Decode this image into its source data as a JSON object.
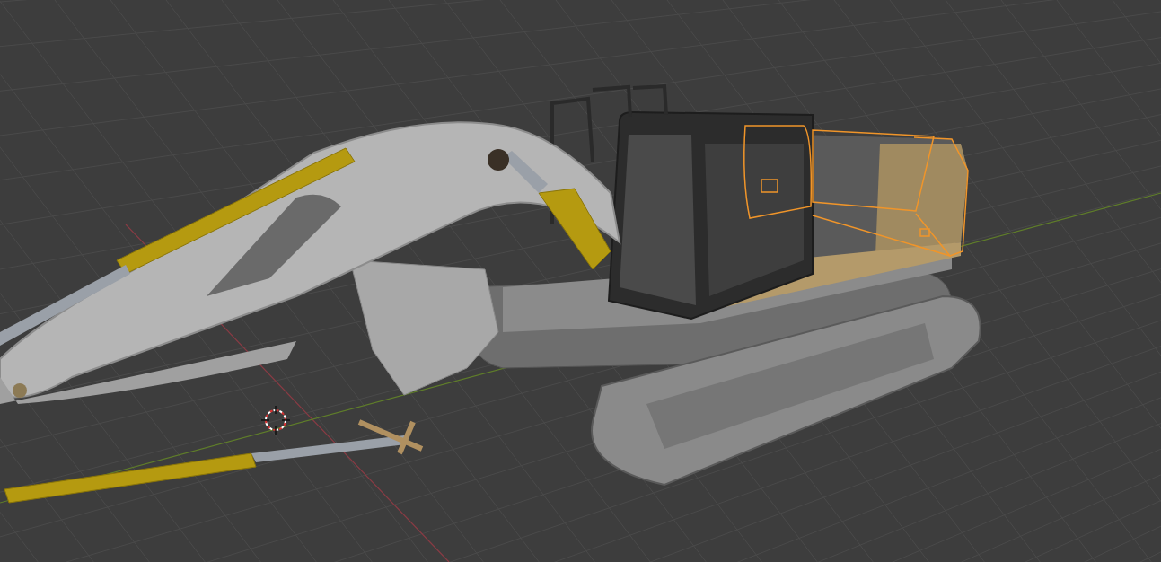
{
  "viewport": {
    "show_grid": true,
    "show_axes": true,
    "show_cursor": true,
    "selection_outline": true
  }
}
